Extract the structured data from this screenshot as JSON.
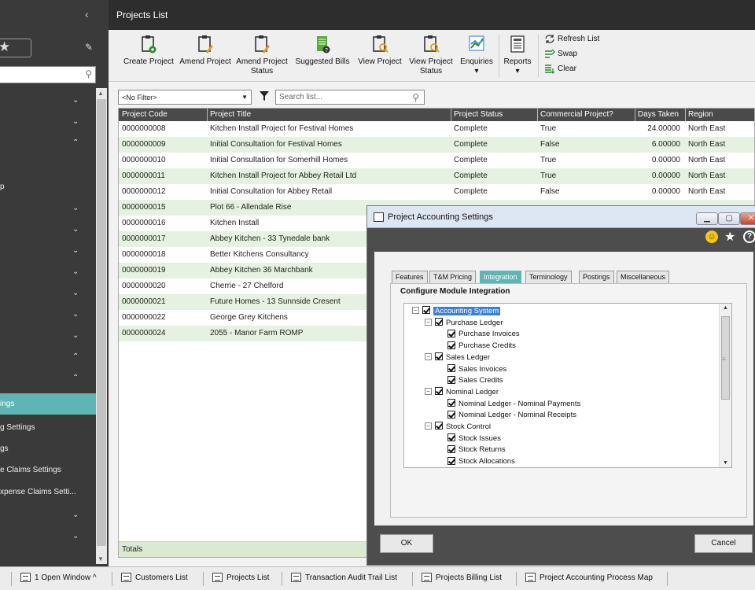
{
  "sidebar": {
    "items": [
      {
        "label": "",
        "chevron": "⌄"
      },
      {
        "label": "",
        "chevron": "⌄"
      },
      {
        "label": "",
        "chevron": "⌃"
      },
      {
        "label": "",
        "chevron": ""
      },
      {
        "label": "p",
        "chevron": ""
      },
      {
        "label": "",
        "chevron": "⌄"
      },
      {
        "label": "",
        "chevron": "⌄"
      },
      {
        "label": "",
        "chevron": "⌄"
      },
      {
        "label": "",
        "chevron": "⌄"
      },
      {
        "label": "",
        "chevron": "⌄"
      },
      {
        "label": "",
        "chevron": "⌄"
      },
      {
        "label": "",
        "chevron": "⌄"
      },
      {
        "label": "",
        "chevron": "⌃"
      },
      {
        "label": "",
        "chevron": "⌃"
      },
      {
        "label": "ings",
        "chevron": ""
      },
      {
        "label": "g Settings",
        "chevron": ""
      },
      {
        "label": "gs",
        "chevron": ""
      },
      {
        "label": "e Claims Settings",
        "chevron": ""
      },
      {
        "label": "xpense Claims Setti...",
        "chevron": ""
      },
      {
        "label": "",
        "chevron": "⌄"
      },
      {
        "label": "",
        "chevron": "⌄"
      }
    ],
    "selected_index": 14
  },
  "window": {
    "title": "Projects List"
  },
  "toolbar": {
    "buttons": [
      {
        "label": "Create Project",
        "sub": ""
      },
      {
        "label": "Amend Project",
        "sub": ""
      },
      {
        "label": "Amend Project",
        "sub": "Status"
      },
      {
        "label": "Suggested Bills",
        "sub": ""
      },
      {
        "label": "View Project",
        "sub": ""
      },
      {
        "label": "View Project",
        "sub": "Status"
      },
      {
        "label": "Enquiries",
        "sub": "▾"
      },
      {
        "label": "Reports",
        "sub": "▾"
      }
    ],
    "refresh": "Refresh List",
    "swap": "Swap",
    "clear": "Clear"
  },
  "filter": {
    "value": "<No Filter>",
    "search_placeholder": "Search list..."
  },
  "grid": {
    "columns": [
      "Project Code",
      "Project Title",
      "Project Status",
      "Commercial Project?",
      "Days Taken",
      "Region"
    ],
    "rows": [
      [
        "0000000008",
        "Kitchen Install Project for Festival Homes",
        "Complete",
        "True",
        "24.00000",
        "North East"
      ],
      [
        "0000000009",
        "Initial Consultation for Festival Homes",
        "Complete",
        "False",
        "6.00000",
        "North East"
      ],
      [
        "0000000010",
        "Initial Consultation for Somerhill Homes",
        "Complete",
        "True",
        "0.00000",
        "North East"
      ],
      [
        "0000000011",
        "Kitchen Install Project for Abbey Retail Ltd",
        "Complete",
        "True",
        "0.00000",
        "North East"
      ],
      [
        "0000000012",
        "Initial Consultation for Abbey Retail",
        "Complete",
        "False",
        "0.00000",
        "North East"
      ],
      [
        "0000000015",
        "Plot 66 - Allendale Rise",
        "",
        "",
        "",
        ""
      ],
      [
        "0000000016",
        "Kitchen Install",
        "",
        "",
        "",
        ""
      ],
      [
        "0000000017",
        "Abbey Kitchen - 33 Tynedale bank",
        "",
        "",
        "",
        ""
      ],
      [
        "0000000018",
        "Better Kitchens Consultancy",
        "",
        "",
        "",
        ""
      ],
      [
        "0000000019",
        "Abbey Kitchen 36 Marchbank",
        "",
        "",
        "",
        ""
      ],
      [
        "0000000020",
        "Cherrie - 27 Chelford",
        "",
        "",
        "",
        ""
      ],
      [
        "0000000021",
        "Future Homes - 13 Sunnside Cresent",
        "",
        "",
        "",
        ""
      ],
      [
        "0000000022",
        "George Grey Kitchens",
        "",
        "",
        "",
        ""
      ],
      [
        "0000000024",
        "2055 - Manor Farm ROMP",
        "",
        "",
        "",
        ""
      ]
    ],
    "totals_label": "Totals"
  },
  "taskbar": {
    "open_windows": "1 Open Window ^",
    "tasks": [
      "Customers List",
      "Projects List",
      "Transaction Audit Trail List",
      "Projects Billing List",
      "Project Accounting Process Map"
    ]
  },
  "dialog": {
    "title": "Project Accounting Settings",
    "tabs": [
      "Features",
      "T&M Pricing",
      "Integration",
      "Terminology",
      "Postings",
      "Miscellaneous"
    ],
    "active_tab": 2,
    "section_title": "Configure Module Integration",
    "tree": [
      {
        "label": "Accounting System",
        "level": 0,
        "expander": "−",
        "selected": true
      },
      {
        "label": "Purchase Ledger",
        "level": 1,
        "expander": "−"
      },
      {
        "label": "Purchase Invoices",
        "level": 2,
        "expander": ""
      },
      {
        "label": "Purchase Credits",
        "level": 2,
        "expander": ""
      },
      {
        "label": "Sales Ledger",
        "level": 1,
        "expander": "−"
      },
      {
        "label": "Sales Invoices",
        "level": 2,
        "expander": ""
      },
      {
        "label": "Sales Credits",
        "level": 2,
        "expander": ""
      },
      {
        "label": "Nominal Ledger",
        "level": 1,
        "expander": "−"
      },
      {
        "label": "Nominal Ledger - Nominal Payments",
        "level": 2,
        "expander": ""
      },
      {
        "label": "Nominal Ledger - Nominal Receipts",
        "level": 2,
        "expander": ""
      },
      {
        "label": "Stock Control",
        "level": 1,
        "expander": "−"
      },
      {
        "label": "Stock Issues",
        "level": 2,
        "expander": ""
      },
      {
        "label": "Stock Returns",
        "level": 2,
        "expander": ""
      },
      {
        "label": "Stock Allocations",
        "level": 2,
        "expander": ""
      }
    ],
    "ok_label": "OK",
    "cancel_label": "Cancel"
  },
  "colors": {
    "accent": "#5fb5b3",
    "grid_alt_row": "#e6f1e1",
    "selection": "#3d7fd6"
  }
}
